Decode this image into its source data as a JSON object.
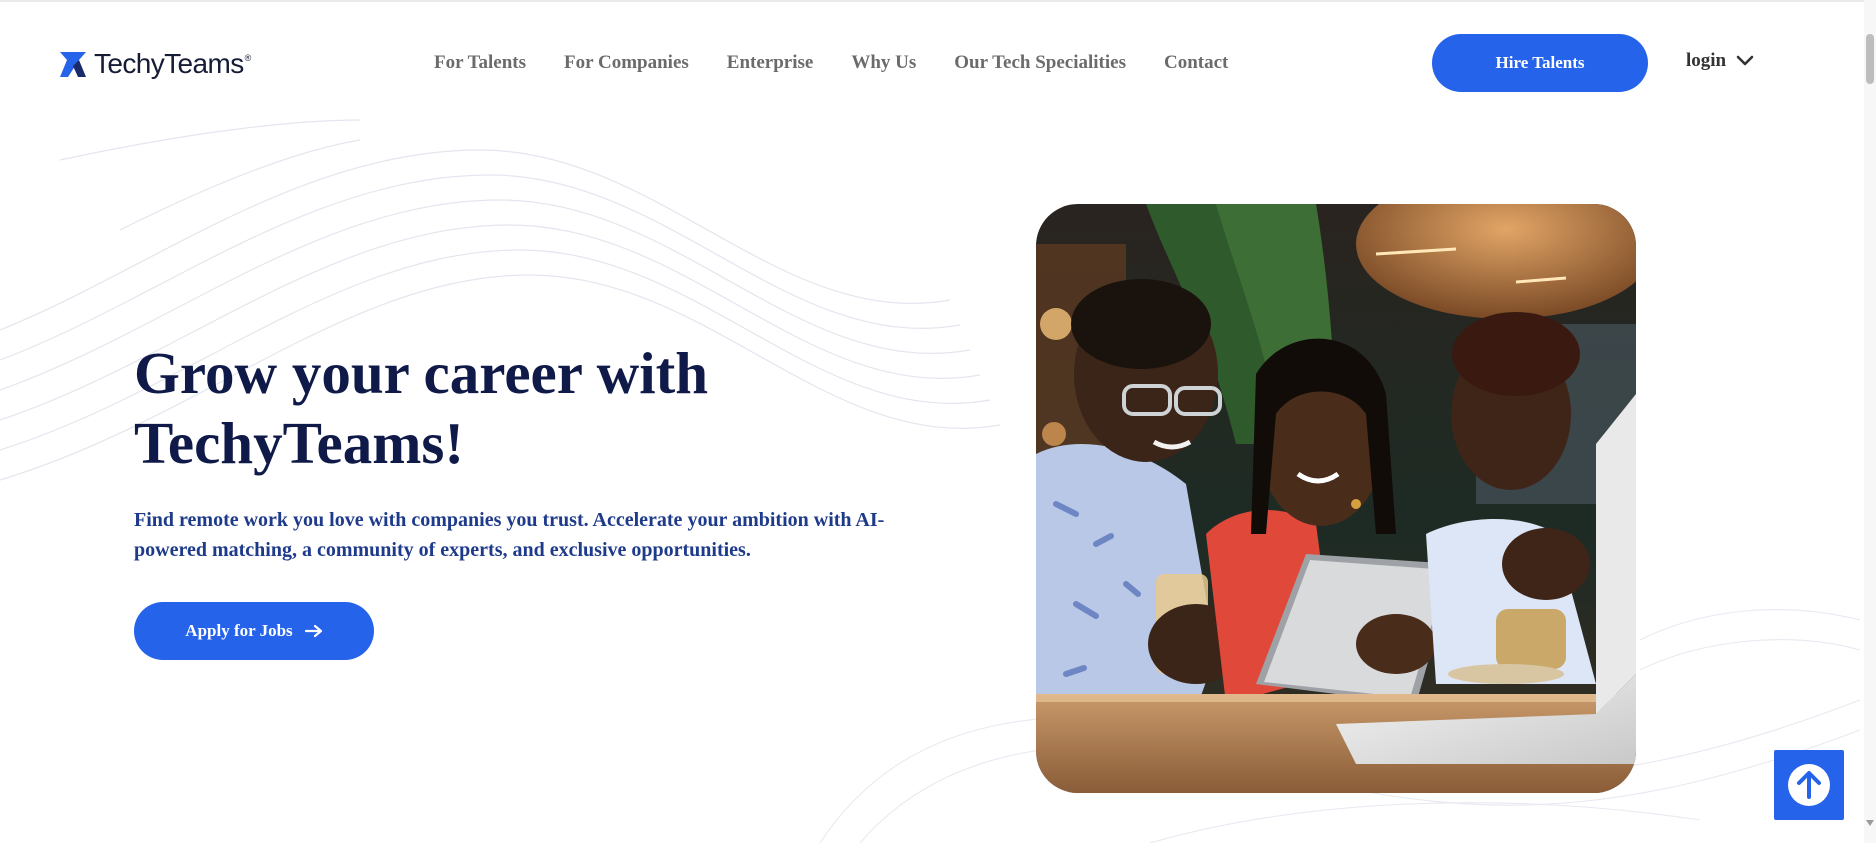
{
  "brand": {
    "name": "TechyTeams",
    "trademark": "®",
    "primary_color": "#2563eb",
    "heading_color": "#0f1a48",
    "subtitle_color": "#1e3a8a"
  },
  "header": {
    "nav": [
      {
        "label": "For Talents"
      },
      {
        "label": "For Companies"
      },
      {
        "label": "Enterprise"
      },
      {
        "label": "Why Us"
      },
      {
        "label": "Our Tech Specialities"
      },
      {
        "label": "Contact"
      }
    ],
    "hire_button": "Hire Talents",
    "login": {
      "label": "login",
      "icon": "chevron-down-icon"
    }
  },
  "hero": {
    "title": "Grow your career with TechyTeams!",
    "subtitle": "Find remote work you love with companies you trust. Accelerate your ambition with AI-powered matching, a community of experts, and exclusive opportunities.",
    "cta": {
      "label": "Apply for Jobs",
      "icon": "arrow-right-icon"
    },
    "image": {
      "subject": "three people looking at a tablet in a cafe"
    }
  },
  "utility": {
    "back_to_top_icon": "arrow-up-circle-icon"
  }
}
